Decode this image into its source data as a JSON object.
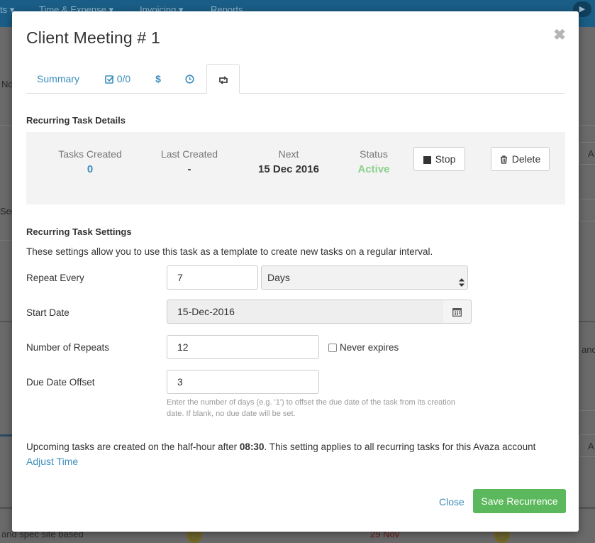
{
  "background": {
    "nav": {
      "item1": "ts ▾",
      "item2": "Time & Expense ▾",
      "item3": "Invoicing ▾",
      "item4": "Reports"
    },
    "left_fragments": {
      "no": "No",
      "sec": "Sec"
    },
    "right_fragments": {
      "a1": "A",
      "and": "and",
      "a2": "A"
    },
    "row": {
      "task_text": "and spec site based",
      "date": "29 Nov"
    }
  },
  "modal": {
    "title": "Client Meeting # 1",
    "tabs": {
      "summary": "Summary",
      "checklist": "0/0",
      "expense": "$"
    },
    "details": {
      "title": "Recurring Task Details",
      "tasks_created_label": "Tasks Created",
      "tasks_created_value": "0",
      "last_created_label": "Last Created",
      "last_created_value": "-",
      "next_label": "Next",
      "next_value": "15 Dec 2016",
      "status_label": "Status",
      "status_value": "Active",
      "stop_label": "Stop",
      "delete_label": "Delete"
    },
    "settings": {
      "title": "Recurring Task Settings",
      "description": "These settings allow you to use this task as a template to create new tasks on a regular interval.",
      "repeat_every_label": "Repeat Every",
      "repeat_every_value": "7",
      "repeat_unit": "Days",
      "start_date_label": "Start Date",
      "start_date_value": "15-Dec-2016",
      "number_of_repeats_label": "Number of Repeats",
      "number_of_repeats_value": "12",
      "never_expires_label": "Never expires",
      "due_date_offset_label": "Due Date Offset",
      "due_date_offset_value": "3",
      "help_text": "Enter the number of days (e.g. '1') to offset the due date of the task from its creation date. If blank, no due date will be set."
    },
    "footer": {
      "note_prefix": "Upcoming tasks are created on the half-hour after ",
      "note_time": "08:30",
      "note_suffix": ". This setting applies to all recurring tasks for this Avaza account",
      "adjust_time": "Adjust Time",
      "close_label": "Close",
      "save_label": "Save Recurrence"
    }
  },
  "colors": {
    "link": "#3c8dbc",
    "active_status": "#8bd18b",
    "success": "#5cb85c",
    "topbar": "#1a5d86"
  }
}
